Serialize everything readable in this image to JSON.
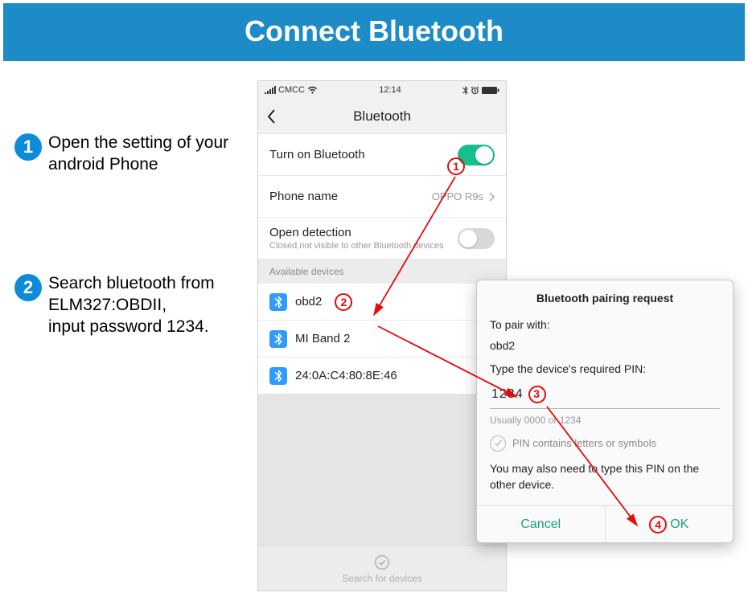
{
  "banner_title": "Connect Bluetooth",
  "steps": [
    {
      "num": "1",
      "text": "Open the setting of your android Phone"
    },
    {
      "num": "2",
      "text": "Search bluetooth from ELM327:OBDII,\ninput password 1234."
    }
  ],
  "phone": {
    "statusbar": {
      "carrier": "CMCC",
      "time": "12:14"
    },
    "nav_title": "Bluetooth",
    "rows": {
      "turn_on": {
        "label": "Turn on Bluetooth",
        "state": "on"
      },
      "phone_name": {
        "label": "Phone name",
        "value": "OPPO R9s"
      },
      "open_detection": {
        "label": "Open detection",
        "sub": "Closed,not visible to other Bluetooth devices",
        "state": "off"
      }
    },
    "section_header": "Available devices",
    "devices": [
      {
        "name": "obd2"
      },
      {
        "name": "MI Band 2"
      },
      {
        "name": "24:0A:C4:80:8E:46"
      }
    ],
    "footer_label": "Search for devices"
  },
  "dialog": {
    "title": "Bluetooth pairing request",
    "to_pair_label": "To pair with:",
    "to_pair_value": "obd2",
    "pin_prompt": "Type the device's required PIN:",
    "pin_value": "1234",
    "pin_hint": "Usually 0000 or 1234",
    "checkbox_label": "PIN contains letters or symbols",
    "note": "You may also need to type this PIN on the other device.",
    "cancel": "Cancel",
    "ok": "OK"
  },
  "red_circles": {
    "r1": "1",
    "r2": "2",
    "r3": "3",
    "r4": "4"
  }
}
